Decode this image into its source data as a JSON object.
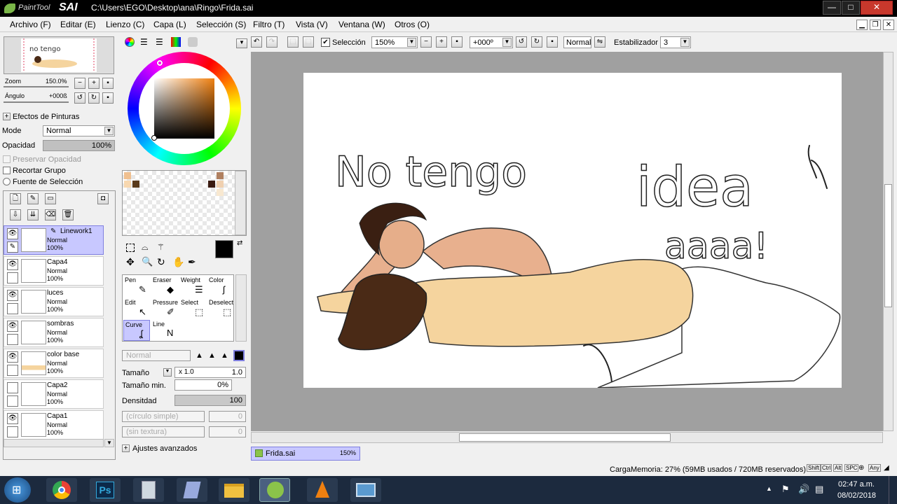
{
  "window": {
    "app_logo_top": "PaintTool",
    "app_logo_main": "SAI",
    "path": "C:\\Users\\EGO\\Desktop\\ana\\Ringo\\Frida.sai",
    "min": "—",
    "max": "□",
    "close": "✕"
  },
  "menu": [
    "Archivo (F)",
    "Editar (E)",
    "Lienzo (C)",
    "Capa (L)",
    "Selección (S)",
    "Filtro (T)",
    "Vista (V)",
    "Ventana (W)",
    "Otros (O)"
  ],
  "navigator": {
    "zoom_label": "Zoom",
    "zoom_value": "150.0%",
    "angle_label": "Ángulo",
    "angle_value": "+000ß"
  },
  "effects": {
    "header": "Efectos de Pinturas",
    "mode_label": "Mode",
    "mode_value": "Normal",
    "opacity_label": "Opacidad",
    "opacity_value": "100%",
    "opacity_fraction": 1.0,
    "preserve": "Preservar Opacidad",
    "clip": "Recortar Grupo",
    "source": "Fuente de Selección"
  },
  "layers": [
    {
      "name": "Linework1",
      "mode": "Normal",
      "opacity": "100%",
      "selected": true
    },
    {
      "name": "Capa4",
      "mode": "Normal",
      "opacity": "100%",
      "selected": false
    },
    {
      "name": "luces",
      "mode": "Normal",
      "opacity": "100%",
      "selected": false
    },
    {
      "name": "sombras",
      "mode": "Normal",
      "opacity": "100%",
      "selected": false
    },
    {
      "name": "color base",
      "mode": "Normal",
      "opacity": "100%",
      "selected": false
    },
    {
      "name": "Capa2",
      "mode": "Normal",
      "opacity": "100%",
      "selected": false
    },
    {
      "name": "Capa1",
      "mode": "Normal",
      "opacity": "100%",
      "selected": false
    }
  ],
  "tools": [
    {
      "label": "Pen",
      "icon": "pen-icon"
    },
    {
      "label": "Eraser",
      "icon": "eraser-icon"
    },
    {
      "label": "Weight",
      "icon": "weight-icon"
    },
    {
      "label": "Color",
      "icon": "color-icon"
    },
    {
      "label": "Edit",
      "icon": "edit-icon"
    },
    {
      "label": "Pressure",
      "icon": "pressure-icon"
    },
    {
      "label": "Select",
      "icon": "select-icon"
    },
    {
      "label": "Deselect",
      "icon": "deselect-icon"
    },
    {
      "label": "Curve",
      "icon": "curve-icon"
    },
    {
      "label": "Line",
      "icon": "line-icon"
    }
  ],
  "brush": {
    "blend": "Normal",
    "size_label": "Tamaño",
    "size_mult": "x 1.0",
    "size_value": "1.0",
    "minsize_label": "Tamaño min.",
    "minsize_value": "0%",
    "density_label": "Densitdad",
    "density_value": "100",
    "circle": "(círculo simple)",
    "circle_val": "0",
    "texture": "(sin textura)",
    "texture_val": "0",
    "advanced": "Ajustes avanzados"
  },
  "toolbar": {
    "selection_label": "Selección",
    "zoom": "150%",
    "angle": "+000º",
    "mode": "Normal",
    "stabilizer_label": "Estabilizador",
    "stabilizer_value": "3"
  },
  "doc_tab": {
    "name": "Frida.sai",
    "zoom": "150%"
  },
  "canvas_text": {
    "line1": "No tengo",
    "line2": "idea",
    "line3": "aaaa!"
  },
  "status": {
    "memory": "CargaMemoria: 27% (59MB usados / 720MB reservados)",
    "keys": [
      "Shift",
      "Ctrl",
      "Alt",
      "SPC",
      "Any"
    ]
  },
  "taskbar": {
    "time": "02:47 a.m.",
    "date": "08/02/2018"
  },
  "colors": {
    "accent": "#8080e0",
    "title_bg": "#000000",
    "taskbar": "#1c2a3e",
    "skin": "#f5d49e",
    "hair": "#4a2a16"
  }
}
